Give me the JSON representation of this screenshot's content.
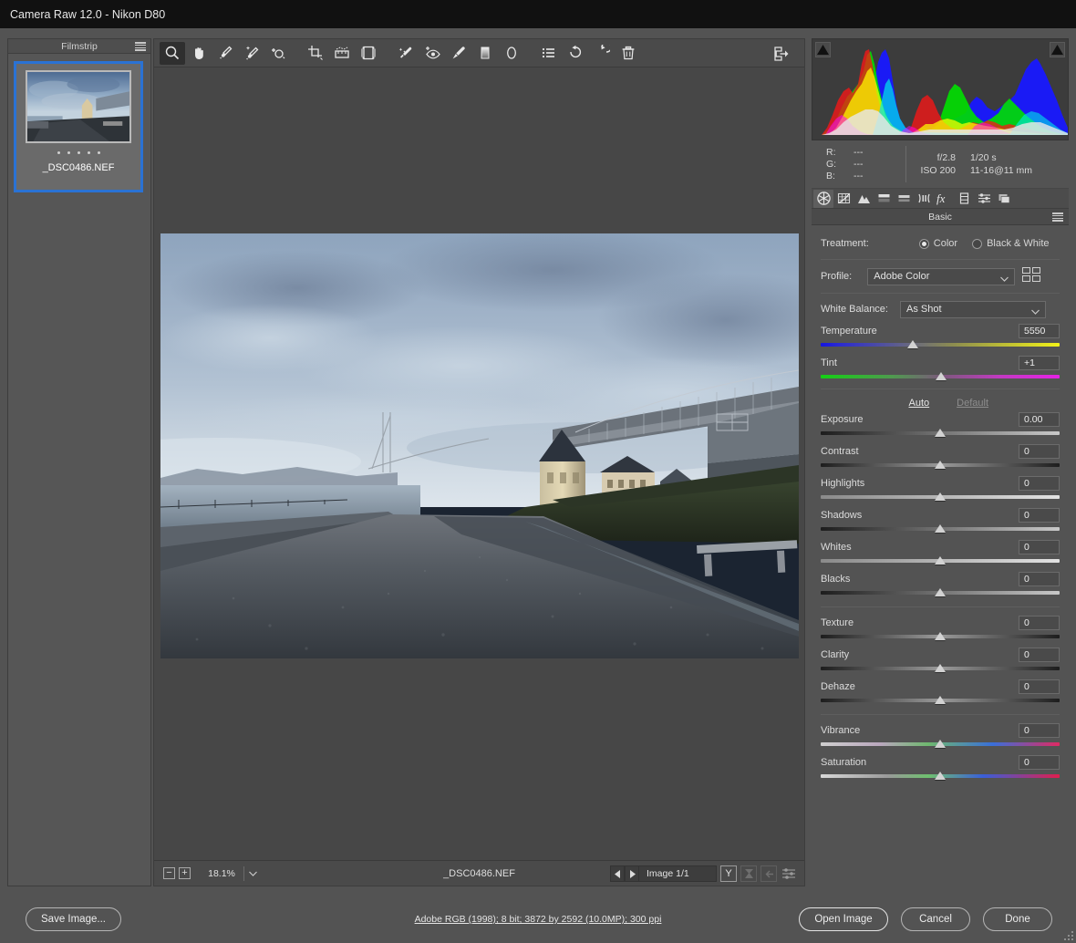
{
  "window": {
    "title": "Camera Raw 12.0  -  Nikon D80"
  },
  "filmstrip": {
    "header": "Filmstrip",
    "menu_icon": "hamburger-menu-icon",
    "thumbnails": [
      {
        "filename": "_DSC0486.NEF",
        "rating_dots": 5,
        "selected": true
      }
    ]
  },
  "toolbar": {
    "tools": [
      {
        "name": "zoom-tool",
        "label": "Zoom",
        "active": true
      },
      {
        "name": "hand-tool",
        "label": "Hand",
        "active": false
      },
      {
        "name": "white-balance-tool",
        "label": "White Balance",
        "active": false
      },
      {
        "name": "color-sampler-tool",
        "label": "Color Sampler",
        "active": false
      },
      {
        "name": "targeted-adjustment-tool",
        "label": "Targeted Adjustment",
        "active": false
      },
      {
        "name": "crop-tool",
        "label": "Crop",
        "active": false
      },
      {
        "name": "straighten-tool",
        "label": "Straighten",
        "active": false
      },
      {
        "name": "transform-tool",
        "label": "Transform",
        "active": false
      },
      {
        "name": "spot-removal-tool",
        "label": "Spot Removal",
        "active": false
      },
      {
        "name": "red-eye-removal-tool",
        "label": "Red Eye Removal",
        "active": false
      },
      {
        "name": "adjustment-brush-tool",
        "label": "Adjustment Brush",
        "active": false
      },
      {
        "name": "graduated-filter-tool",
        "label": "Graduated Filter",
        "active": false
      },
      {
        "name": "radial-filter-tool",
        "label": "Radial Filter",
        "active": false
      },
      {
        "name": "presets-tool",
        "label": "Presets",
        "active": false
      },
      {
        "name": "rotate-counterclockwise-tool",
        "label": "Rotate Counterclockwise",
        "active": false
      },
      {
        "name": "rotate-clockwise-tool",
        "label": "Rotate Clockwise",
        "active": false
      },
      {
        "name": "delete-tool",
        "label": "Delete",
        "active": false
      }
    ],
    "fullscreen_label": "Toggle Full Screen Mode"
  },
  "statusbar": {
    "zoom_out": "−",
    "zoom_in": "+",
    "zoom_value": "18.1%",
    "filename": "_DSC0486.NEF",
    "prev_arrow": "◀",
    "next_arrow": "▶",
    "image_counter": "Image 1/1",
    "before_after_label": "Y",
    "swap_label": "swap-before-after-icon",
    "copy_label": "copy-settings-icon",
    "settings_label": "preview-preferences-icon"
  },
  "histogram": {
    "shadow_clip_label": "shadow-clipping-warning",
    "highlight_clip_label": "highlight-clipping-warning"
  },
  "metadata": {
    "rgb": [
      {
        "channel": "R:",
        "value": "---"
      },
      {
        "channel": "G:",
        "value": "---"
      },
      {
        "channel": "B:",
        "value": "---"
      }
    ],
    "exif": [
      {
        "left": "f/2.8",
        "right": "1/20 s"
      },
      {
        "left": "ISO 200",
        "right": "11-16@11 mm"
      }
    ]
  },
  "panel_tabs": [
    {
      "name": "tab-basic",
      "label": "Basic",
      "icon": "aperture-icon",
      "active": true
    },
    {
      "name": "tab-tone-curve",
      "label": "Tone Curve",
      "icon": "curve-grid-icon",
      "active": false
    },
    {
      "name": "tab-detail",
      "label": "Detail",
      "icon": "mountains-icon",
      "active": false
    },
    {
      "name": "tab-hsl-grayscale",
      "label": "HSL / Grayscale",
      "icon": "hsl-bars-icon",
      "active": false
    },
    {
      "name": "tab-split-toning",
      "label": "Split Toning",
      "icon": "split-tone-icon",
      "active": false
    },
    {
      "name": "tab-lens-corrections",
      "label": "Lens Corrections",
      "icon": "lens-icon",
      "active": false
    },
    {
      "name": "tab-effects",
      "label": "Effects",
      "icon": "fx-icon",
      "active": false
    },
    {
      "name": "tab-calibration",
      "label": "Camera Calibration",
      "icon": "filmstrip-icon",
      "active": false
    },
    {
      "name": "tab-presets",
      "label": "Presets",
      "icon": "sliders-icon",
      "active": false
    },
    {
      "name": "tab-snapshots",
      "label": "Snapshots",
      "icon": "layers-icon",
      "active": false
    }
  ],
  "basic_panel": {
    "title": "Basic",
    "menu_icon": "panel-menu-icon",
    "treatment": {
      "label": "Treatment:",
      "options": [
        {
          "label": "Color",
          "selected": true
        },
        {
          "label": "Black & White",
          "selected": false
        }
      ]
    },
    "profile": {
      "label": "Profile:",
      "value": "Adobe Color",
      "browse_icon": "profile-browser-icon"
    },
    "white_balance": {
      "label": "White Balance:",
      "value": "As Shot"
    },
    "auto_label": "Auto",
    "default_label": "Default",
    "sliders": [
      {
        "name": "temperature",
        "label": "Temperature",
        "value": "5550",
        "pos": 38.5,
        "rail": "temp"
      },
      {
        "name": "tint",
        "label": "Tint",
        "value": "+1",
        "pos": 50.5,
        "rail": "tint"
      },
      {
        "name": "exposure",
        "label": "Exposure",
        "value": "0.00",
        "pos": 50.0,
        "rail": "gray"
      },
      {
        "name": "contrast",
        "label": "Contrast",
        "value": "0",
        "pos": 50.0,
        "rail": "graymid"
      },
      {
        "name": "highlights",
        "label": "Highlights",
        "value": "0",
        "pos": 50.0,
        "rail": "light"
      },
      {
        "name": "shadows",
        "label": "Shadows",
        "value": "0",
        "pos": 50.0,
        "rail": "gray"
      },
      {
        "name": "whites",
        "label": "Whites",
        "value": "0",
        "pos": 50.0,
        "rail": "light"
      },
      {
        "name": "blacks",
        "label": "Blacks",
        "value": "0",
        "pos": 50.0,
        "rail": "blacks"
      },
      {
        "name": "texture",
        "label": "Texture",
        "value": "0",
        "pos": 50.0,
        "rail": "graymid"
      },
      {
        "name": "clarity",
        "label": "Clarity",
        "value": "0",
        "pos": 50.0,
        "rail": "graymid"
      },
      {
        "name": "dehaze",
        "label": "Dehaze",
        "value": "0",
        "pos": 50.0,
        "rail": "graymid"
      },
      {
        "name": "vibrance",
        "label": "Vibrance",
        "value": "0",
        "pos": 50.0,
        "rail": "vib"
      },
      {
        "name": "saturation",
        "label": "Saturation",
        "value": "0",
        "pos": 50.0,
        "rail": "sat"
      }
    ]
  },
  "bottombar": {
    "save_image": "Save Image...",
    "workflow_options": "Adobe RGB (1998); 8 bit; 3872 by 2592 (10.0MP); 300 ppi",
    "open_image": "Open Image",
    "cancel": "Cancel",
    "done": "Done"
  },
  "colors": {
    "selection_blue": "#2a72d4",
    "panel_bg": "#535353",
    "titlebar_bg": "#111111",
    "canvas_bg": "#474747"
  }
}
